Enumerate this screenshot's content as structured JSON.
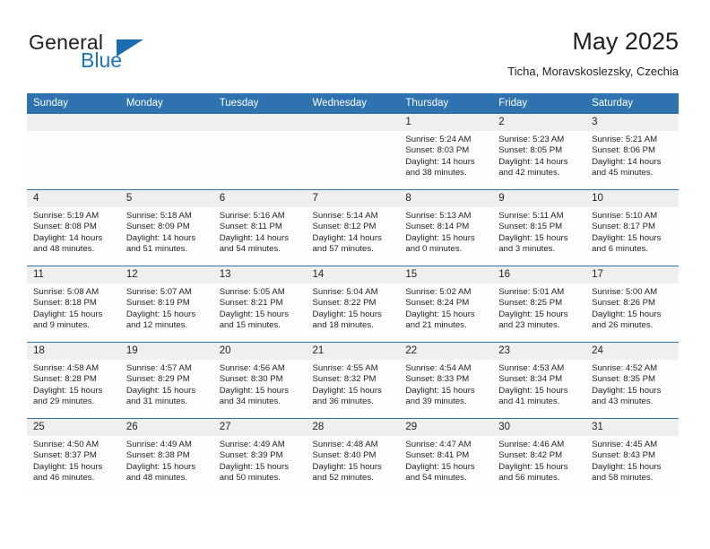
{
  "brand": {
    "word1": "General",
    "word2": "Blue",
    "logo_icon": "triangle-icon",
    "accent_color": "#1b6cb0"
  },
  "header": {
    "month_title": "May 2025",
    "location": "Ticha, Moravskoslezsky, Czechia"
  },
  "theme": {
    "header_bg": "#2e72b0",
    "daynum_bg": "#efefef",
    "cell_bg": "#fdfdfd",
    "text": "#231f20"
  },
  "weekdays": [
    "Sunday",
    "Monday",
    "Tuesday",
    "Wednesday",
    "Thursday",
    "Friday",
    "Saturday"
  ],
  "weeks": [
    [
      {
        "day": "",
        "empty": true,
        "sunrise": "",
        "sunset": "",
        "daylight1": "",
        "daylight2": ""
      },
      {
        "day": "",
        "empty": true,
        "sunrise": "",
        "sunset": "",
        "daylight1": "",
        "daylight2": ""
      },
      {
        "day": "",
        "empty": true,
        "sunrise": "",
        "sunset": "",
        "daylight1": "",
        "daylight2": ""
      },
      {
        "day": "",
        "empty": true,
        "sunrise": "",
        "sunset": "",
        "daylight1": "",
        "daylight2": ""
      },
      {
        "day": "1",
        "empty": false,
        "sunrise": "Sunrise: 5:24 AM",
        "sunset": "Sunset: 8:03 PM",
        "daylight1": "Daylight: 14 hours",
        "daylight2": "and 38 minutes."
      },
      {
        "day": "2",
        "empty": false,
        "sunrise": "Sunrise: 5:23 AM",
        "sunset": "Sunset: 8:05 PM",
        "daylight1": "Daylight: 14 hours",
        "daylight2": "and 42 minutes."
      },
      {
        "day": "3",
        "empty": false,
        "sunrise": "Sunrise: 5:21 AM",
        "sunset": "Sunset: 8:06 PM",
        "daylight1": "Daylight: 14 hours",
        "daylight2": "and 45 minutes."
      }
    ],
    [
      {
        "day": "4",
        "empty": false,
        "sunrise": "Sunrise: 5:19 AM",
        "sunset": "Sunset: 8:08 PM",
        "daylight1": "Daylight: 14 hours",
        "daylight2": "and 48 minutes."
      },
      {
        "day": "5",
        "empty": false,
        "sunrise": "Sunrise: 5:18 AM",
        "sunset": "Sunset: 8:09 PM",
        "daylight1": "Daylight: 14 hours",
        "daylight2": "and 51 minutes."
      },
      {
        "day": "6",
        "empty": false,
        "sunrise": "Sunrise: 5:16 AM",
        "sunset": "Sunset: 8:11 PM",
        "daylight1": "Daylight: 14 hours",
        "daylight2": "and 54 minutes."
      },
      {
        "day": "7",
        "empty": false,
        "sunrise": "Sunrise: 5:14 AM",
        "sunset": "Sunset: 8:12 PM",
        "daylight1": "Daylight: 14 hours",
        "daylight2": "and 57 minutes."
      },
      {
        "day": "8",
        "empty": false,
        "sunrise": "Sunrise: 5:13 AM",
        "sunset": "Sunset: 8:14 PM",
        "daylight1": "Daylight: 15 hours",
        "daylight2": "and 0 minutes."
      },
      {
        "day": "9",
        "empty": false,
        "sunrise": "Sunrise: 5:11 AM",
        "sunset": "Sunset: 8:15 PM",
        "daylight1": "Daylight: 15 hours",
        "daylight2": "and 3 minutes."
      },
      {
        "day": "10",
        "empty": false,
        "sunrise": "Sunrise: 5:10 AM",
        "sunset": "Sunset: 8:17 PM",
        "daylight1": "Daylight: 15 hours",
        "daylight2": "and 6 minutes."
      }
    ],
    [
      {
        "day": "11",
        "empty": false,
        "sunrise": "Sunrise: 5:08 AM",
        "sunset": "Sunset: 8:18 PM",
        "daylight1": "Daylight: 15 hours",
        "daylight2": "and 9 minutes."
      },
      {
        "day": "12",
        "empty": false,
        "sunrise": "Sunrise: 5:07 AM",
        "sunset": "Sunset: 8:19 PM",
        "daylight1": "Daylight: 15 hours",
        "daylight2": "and 12 minutes."
      },
      {
        "day": "13",
        "empty": false,
        "sunrise": "Sunrise: 5:05 AM",
        "sunset": "Sunset: 8:21 PM",
        "daylight1": "Daylight: 15 hours",
        "daylight2": "and 15 minutes."
      },
      {
        "day": "14",
        "empty": false,
        "sunrise": "Sunrise: 5:04 AM",
        "sunset": "Sunset: 8:22 PM",
        "daylight1": "Daylight: 15 hours",
        "daylight2": "and 18 minutes."
      },
      {
        "day": "15",
        "empty": false,
        "sunrise": "Sunrise: 5:02 AM",
        "sunset": "Sunset: 8:24 PM",
        "daylight1": "Daylight: 15 hours",
        "daylight2": "and 21 minutes."
      },
      {
        "day": "16",
        "empty": false,
        "sunrise": "Sunrise: 5:01 AM",
        "sunset": "Sunset: 8:25 PM",
        "daylight1": "Daylight: 15 hours",
        "daylight2": "and 23 minutes."
      },
      {
        "day": "17",
        "empty": false,
        "sunrise": "Sunrise: 5:00 AM",
        "sunset": "Sunset: 8:26 PM",
        "daylight1": "Daylight: 15 hours",
        "daylight2": "and 26 minutes."
      }
    ],
    [
      {
        "day": "18",
        "empty": false,
        "sunrise": "Sunrise: 4:58 AM",
        "sunset": "Sunset: 8:28 PM",
        "daylight1": "Daylight: 15 hours",
        "daylight2": "and 29 minutes."
      },
      {
        "day": "19",
        "empty": false,
        "sunrise": "Sunrise: 4:57 AM",
        "sunset": "Sunset: 8:29 PM",
        "daylight1": "Daylight: 15 hours",
        "daylight2": "and 31 minutes."
      },
      {
        "day": "20",
        "empty": false,
        "sunrise": "Sunrise: 4:56 AM",
        "sunset": "Sunset: 8:30 PM",
        "daylight1": "Daylight: 15 hours",
        "daylight2": "and 34 minutes."
      },
      {
        "day": "21",
        "empty": false,
        "sunrise": "Sunrise: 4:55 AM",
        "sunset": "Sunset: 8:32 PM",
        "daylight1": "Daylight: 15 hours",
        "daylight2": "and 36 minutes."
      },
      {
        "day": "22",
        "empty": false,
        "sunrise": "Sunrise: 4:54 AM",
        "sunset": "Sunset: 8:33 PM",
        "daylight1": "Daylight: 15 hours",
        "daylight2": "and 39 minutes."
      },
      {
        "day": "23",
        "empty": false,
        "sunrise": "Sunrise: 4:53 AM",
        "sunset": "Sunset: 8:34 PM",
        "daylight1": "Daylight: 15 hours",
        "daylight2": "and 41 minutes."
      },
      {
        "day": "24",
        "empty": false,
        "sunrise": "Sunrise: 4:52 AM",
        "sunset": "Sunset: 8:35 PM",
        "daylight1": "Daylight: 15 hours",
        "daylight2": "and 43 minutes."
      }
    ],
    [
      {
        "day": "25",
        "empty": false,
        "sunrise": "Sunrise: 4:50 AM",
        "sunset": "Sunset: 8:37 PM",
        "daylight1": "Daylight: 15 hours",
        "daylight2": "and 46 minutes."
      },
      {
        "day": "26",
        "empty": false,
        "sunrise": "Sunrise: 4:49 AM",
        "sunset": "Sunset: 8:38 PM",
        "daylight1": "Daylight: 15 hours",
        "daylight2": "and 48 minutes."
      },
      {
        "day": "27",
        "empty": false,
        "sunrise": "Sunrise: 4:49 AM",
        "sunset": "Sunset: 8:39 PM",
        "daylight1": "Daylight: 15 hours",
        "daylight2": "and 50 minutes."
      },
      {
        "day": "28",
        "empty": false,
        "sunrise": "Sunrise: 4:48 AM",
        "sunset": "Sunset: 8:40 PM",
        "daylight1": "Daylight: 15 hours",
        "daylight2": "and 52 minutes."
      },
      {
        "day": "29",
        "empty": false,
        "sunrise": "Sunrise: 4:47 AM",
        "sunset": "Sunset: 8:41 PM",
        "daylight1": "Daylight: 15 hours",
        "daylight2": "and 54 minutes."
      },
      {
        "day": "30",
        "empty": false,
        "sunrise": "Sunrise: 4:46 AM",
        "sunset": "Sunset: 8:42 PM",
        "daylight1": "Daylight: 15 hours",
        "daylight2": "and 56 minutes."
      },
      {
        "day": "31",
        "empty": false,
        "sunrise": "Sunrise: 4:45 AM",
        "sunset": "Sunset: 8:43 PM",
        "daylight1": "Daylight: 15 hours",
        "daylight2": "and 58 minutes."
      }
    ]
  ]
}
